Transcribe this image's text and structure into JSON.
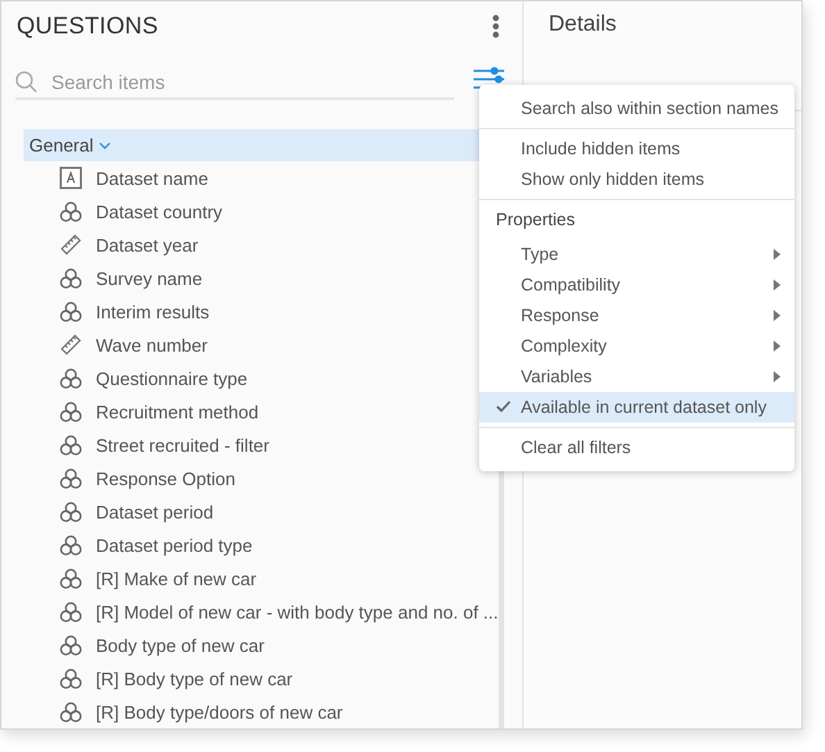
{
  "questions_panel": {
    "title": "QUESTIONS",
    "search": {
      "placeholder": "Search items"
    },
    "tree": [
      {
        "label": "General",
        "expanded": true,
        "selected": true,
        "children": [
          {
            "label": "Dataset name",
            "kind": "text",
            "selected": false
          },
          {
            "label": "Dataset country",
            "kind": "category",
            "selected": false
          },
          {
            "label": "Dataset year",
            "kind": "numeric",
            "selected": false
          },
          {
            "label": "Survey name",
            "kind": "category",
            "selected": false
          },
          {
            "label": "Interim results",
            "kind": "category",
            "selected": false
          },
          {
            "label": "Wave number",
            "kind": "numeric",
            "selected": false
          },
          {
            "label": "Questionnaire type",
            "kind": "category",
            "selected": false
          },
          {
            "label": "Recruitment method",
            "kind": "category",
            "selected": false
          },
          {
            "label": "Street recruited - filter",
            "kind": "category",
            "selected": false
          },
          {
            "label": "Response Option",
            "kind": "category",
            "selected": false
          },
          {
            "label": "Dataset period",
            "kind": "category",
            "selected": false
          },
          {
            "label": "Dataset period type",
            "kind": "category",
            "selected": false
          },
          {
            "label": "[R] Make of new car",
            "kind": "category",
            "selected": false
          },
          {
            "label": "[R] Model of new car - with body type and no. of ...",
            "kind": "category",
            "selected": false
          },
          {
            "label": "Body type of new car",
            "kind": "category",
            "selected": false
          },
          {
            "label": "[R] Body type of new car",
            "kind": "category",
            "selected": false
          },
          {
            "label": "[R] Body type/doors of new car",
            "kind": "category",
            "selected": false
          }
        ]
      }
    ]
  },
  "details_panel": {
    "title": "Details"
  },
  "filter_menu": {
    "sections": [
      {
        "items": [
          {
            "label": "Search also within section names",
            "kind": "option",
            "checked": false
          }
        ]
      },
      {
        "items": [
          {
            "label": "Include hidden items",
            "kind": "option",
            "checked": false
          },
          {
            "label": "Show only hidden items",
            "kind": "option",
            "checked": false
          }
        ]
      },
      {
        "heading": "Properties",
        "items": [
          {
            "label": "Type",
            "kind": "submenu"
          },
          {
            "label": "Compatibility",
            "kind": "submenu"
          },
          {
            "label": "Response",
            "kind": "submenu"
          },
          {
            "label": "Complexity",
            "kind": "submenu"
          },
          {
            "label": "Variables",
            "kind": "submenu"
          },
          {
            "label": "Available in current dataset only",
            "kind": "option",
            "checked": true
          }
        ]
      },
      {
        "items": [
          {
            "label": "Clear all filters",
            "kind": "action"
          }
        ]
      }
    ]
  }
}
